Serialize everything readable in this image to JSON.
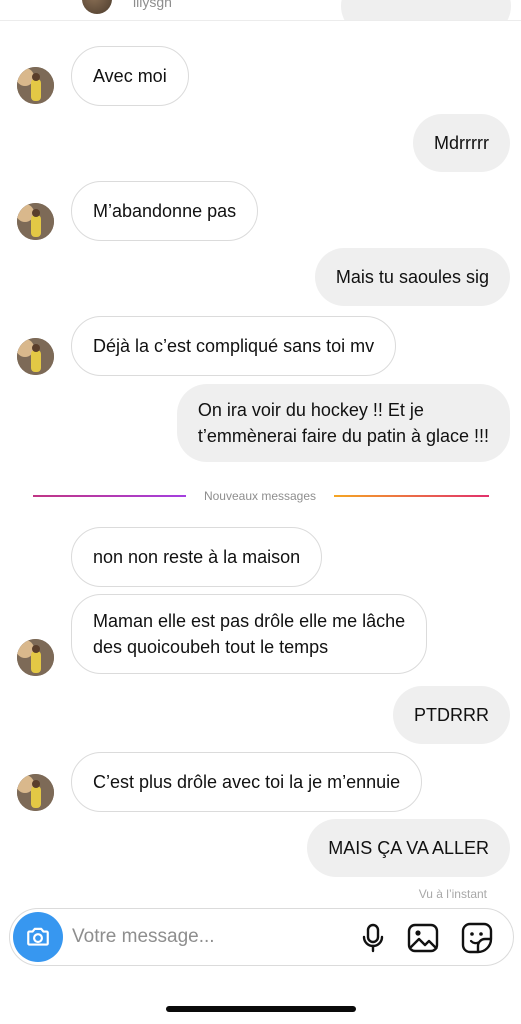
{
  "header": {
    "username": "lilysgh"
  },
  "messages": [
    {
      "from": "them",
      "text": "Avec moi"
    },
    {
      "from": "me",
      "text": "Mdrrrrr"
    },
    {
      "from": "them",
      "text": "M’abandonne pas"
    },
    {
      "from": "me",
      "text": "Mais tu saoules sig"
    },
    {
      "from": "them",
      "text": "Déjà la c’est compliqué sans toi mv"
    },
    {
      "from": "me",
      "lines": [
        "On ira voir du hockey !! Et je",
        "t’emmènerai faire du patin à glace !!!"
      ]
    },
    {
      "from": "them",
      "text": "non non reste à la maison"
    },
    {
      "from": "them",
      "lines": [
        "Maman elle est pas drôle elle me lâche",
        "des quoicoubeh tout le temps"
      ]
    },
    {
      "from": "me",
      "text": "PTDRRR"
    },
    {
      "from": "them",
      "text": "C’est plus drôle avec toi la je m’ennuie"
    },
    {
      "from": "me",
      "text": "MAIS ÇA VA ALLER"
    }
  ],
  "divider": {
    "label": "Nouveaux messages"
  },
  "seen_status": "Vu à l’instant",
  "composer": {
    "placeholder": "Votre message...",
    "icons": [
      "camera-icon",
      "microphone-icon",
      "gallery-icon",
      "sticker-icon"
    ]
  },
  "colors": {
    "accent": "#3797f0",
    "incoming_bubble": "#ffffff",
    "outgoing_bubble": "#efefef",
    "divider_left": "#c13584",
    "divider_right": "#f5a623"
  }
}
